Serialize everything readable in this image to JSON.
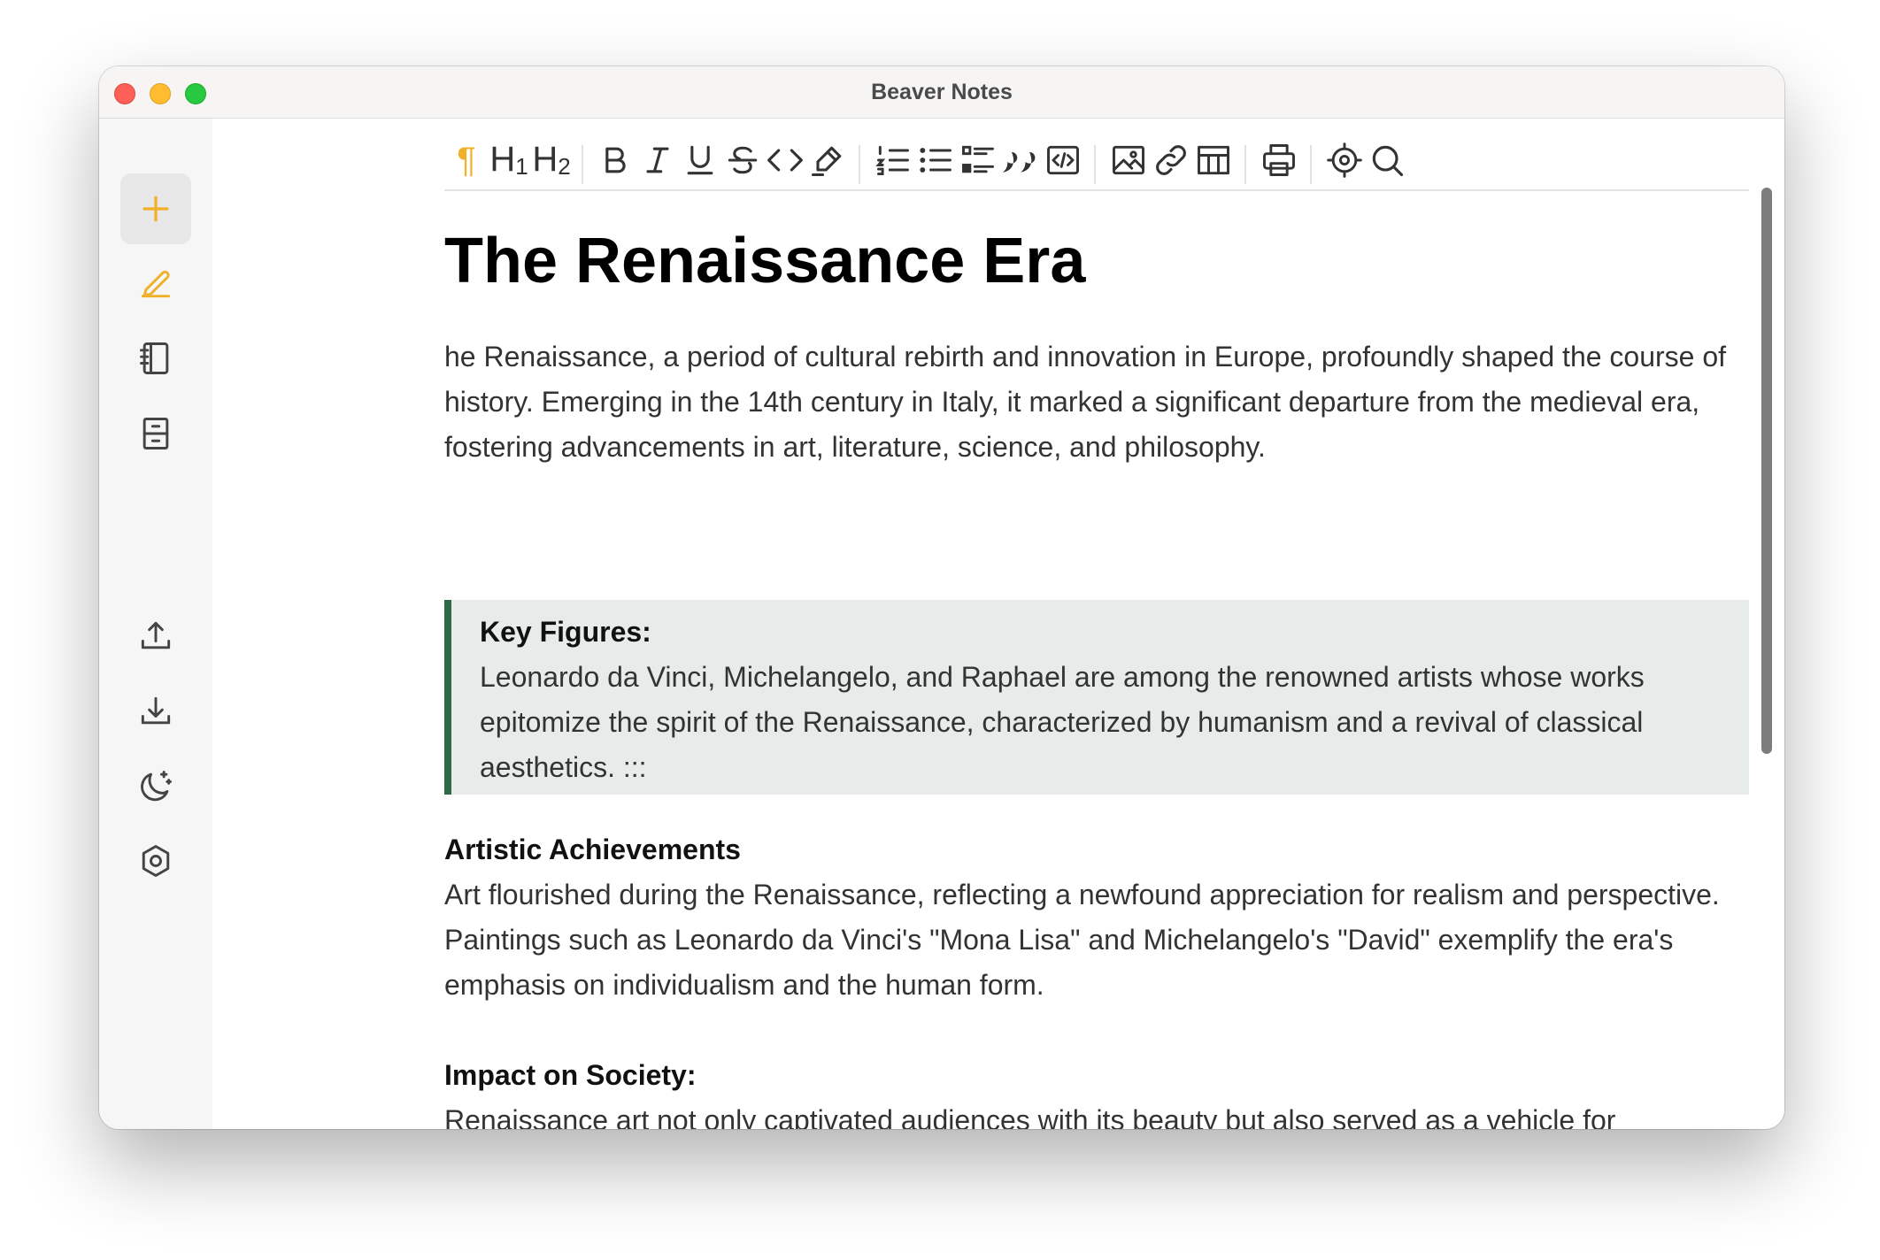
{
  "window": {
    "title": "Beaver Notes"
  },
  "sidebar": {
    "items": [
      {
        "icon": "plus-icon",
        "label": "New note"
      },
      {
        "icon": "pencil-icon",
        "label": "Notes"
      },
      {
        "icon": "notebook-icon",
        "label": "Notebook"
      },
      {
        "icon": "archive-icon",
        "label": "Archive"
      },
      {
        "icon": "upload-icon",
        "label": "Export"
      },
      {
        "icon": "download-icon",
        "label": "Import"
      },
      {
        "icon": "moon-icon",
        "label": "Theme"
      },
      {
        "icon": "settings-icon",
        "label": "Settings"
      }
    ],
    "accent_color": "#f0b02a"
  },
  "toolbar": {
    "paragraph": "¶",
    "h1": "H",
    "h1_sub": "1",
    "h2": "H",
    "h2_sub": "2",
    "accent_color": "#f0b02a"
  },
  "document": {
    "title": "The Renaissance Era",
    "intro": "he Renaissance, a period of cultural rebirth and innovation in Europe, profoundly shaped the course of history. Emerging in the 14th century in Italy, it marked a significant departure from the medieval era, fostering advancements in art, literature, science, and philosophy.",
    "callout": {
      "heading": "Key Figures:",
      "body": "Leonardo da Vinci, Michelangelo, and Raphael are among the renowned artists whose works epitomize the spirit of the Renaissance, characterized by humanism and a revival of classical aesthetics. :::",
      "border_color": "#2f6a45",
      "background": "#e7ecea"
    },
    "section1": {
      "heading": "Artistic Achievements",
      "body": "Art flourished during the Renaissance, reflecting a newfound appreciation for realism and perspective. Paintings such as Leonardo da Vinci's \"Mona Lisa\" and Michelangelo's \"David\" exemplify the era's emphasis on individualism and the human form."
    },
    "section2": {
      "heading": "Impact on Society:",
      "body": "Renaissance art not only captivated audiences with its beauty but also served as a vehicle for expressing cultural, religious, and political ideals, shaping public discourse and societal values. ::"
    }
  }
}
